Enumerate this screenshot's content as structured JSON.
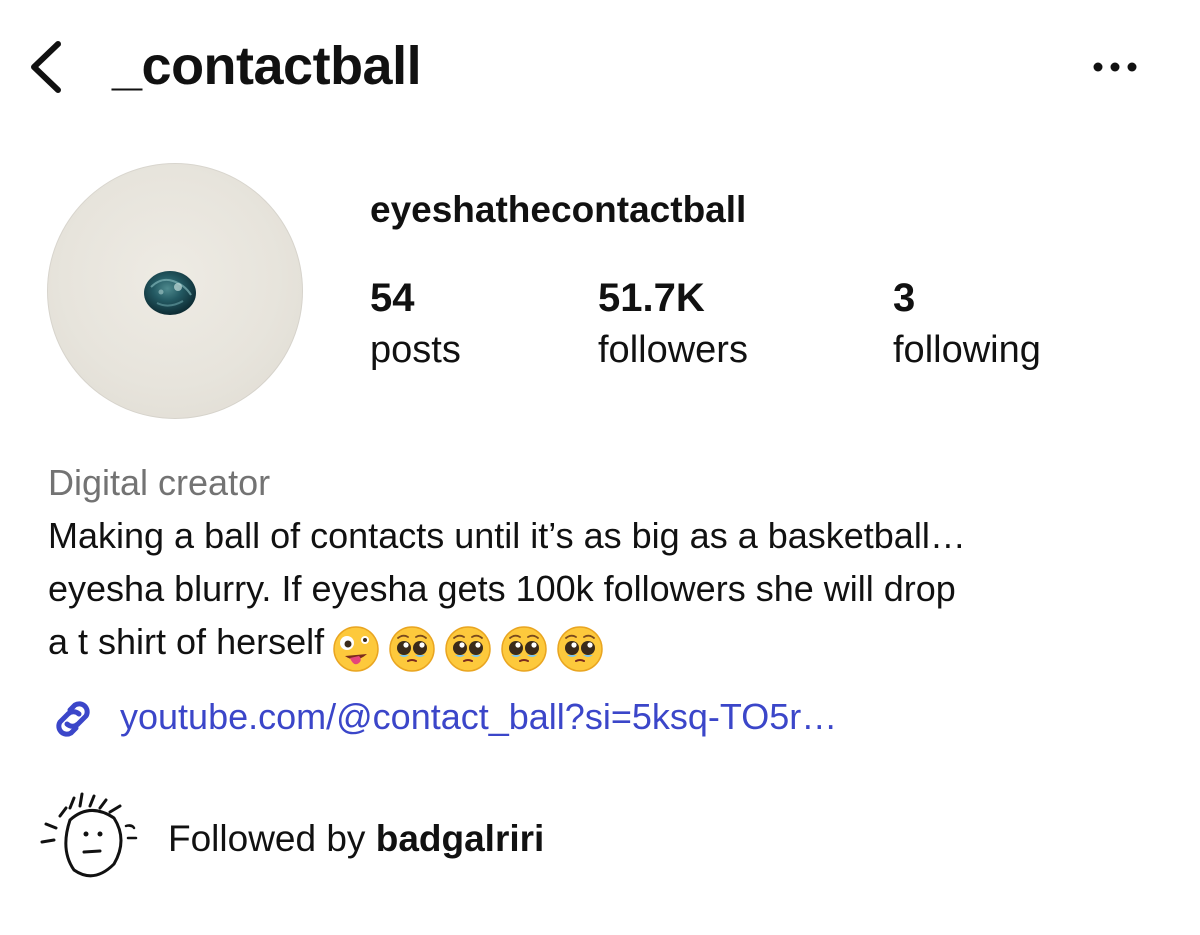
{
  "header": {
    "username": "_contactball",
    "back_icon": "chevron-left-icon",
    "more_icon": "more-horizontal-icon"
  },
  "profile": {
    "name": "eyeshathecontactball",
    "stats": [
      {
        "value": "54",
        "label": "posts"
      },
      {
        "value": "51.7K",
        "label": "followers"
      },
      {
        "value": "3",
        "label": "following"
      }
    ],
    "category": "Digital creator",
    "bio_lines": [
      "Making a ball of contacts until it’s as big as a basketball…",
      "eyesha blurry. If eyesha gets 100k followers she will drop",
      "a t shirt of herself"
    ],
    "bio_emojis": [
      "zany-face-emoji",
      "pleading-face-emoji",
      "pleading-face-emoji",
      "pleading-face-emoji",
      "pleading-face-emoji"
    ],
    "link": {
      "text": "youtube.com/@contact_ball?si=5ksq-TO5r…",
      "icon": "link-icon",
      "color": "#3b46c9"
    },
    "followed_by": {
      "prefix": "Followed by ",
      "user": "badgalriri"
    }
  },
  "colors": {
    "text": "#111111",
    "category": "#737373",
    "link": "#3b46c9",
    "background": "#ffffff"
  }
}
